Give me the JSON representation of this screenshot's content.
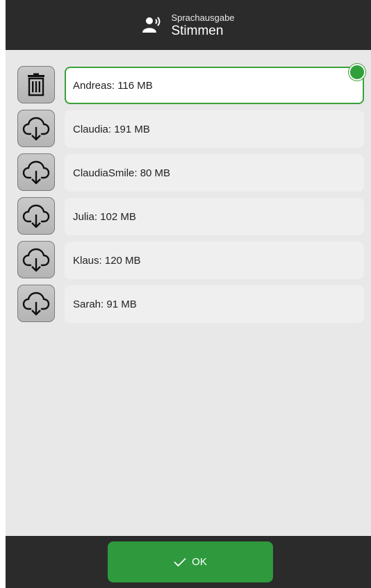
{
  "header": {
    "subtitle": "Sprachausgabe",
    "title": "Stimmen",
    "icon": "speaking-person-icon"
  },
  "voices": [
    {
      "label": "Andreas: 116 MB",
      "action": "delete",
      "action_icon": "trash-icon",
      "selected": true
    },
    {
      "label": "Claudia: 191 MB",
      "action": "download",
      "action_icon": "cloud-download-icon",
      "selected": false
    },
    {
      "label": "ClaudiaSmile: 80 MB",
      "action": "download",
      "action_icon": "cloud-download-icon",
      "selected": false
    },
    {
      "label": "Julia: 102 MB",
      "action": "download",
      "action_icon": "cloud-download-icon",
      "selected": false
    },
    {
      "label": "Klaus: 120 MB",
      "action": "download",
      "action_icon": "cloud-download-icon",
      "selected": false
    },
    {
      "label": "Sarah: 91 MB",
      "action": "download",
      "action_icon": "cloud-download-icon",
      "selected": false
    }
  ],
  "footer": {
    "ok_label": "OK",
    "ok_icon": "checkmark-icon"
  },
  "colors": {
    "header_bg": "#2b2b2b",
    "accent_green": "#2e9a3d",
    "list_bg": "#e8e8e8"
  }
}
